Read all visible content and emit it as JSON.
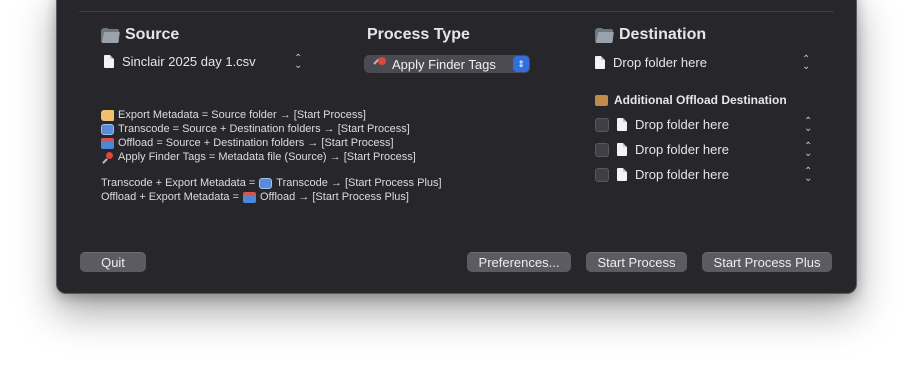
{
  "source": {
    "header": "Source",
    "file_name": "Sinclair 2025 day 1.csv"
  },
  "process_type": {
    "header": "Process Type",
    "selected": "Apply Finder Tags"
  },
  "destination": {
    "header": "Destination",
    "placeholder": "Drop folder here"
  },
  "additional_offload": {
    "header": "Additional Offload Destination",
    "rows": [
      {
        "label": "Drop folder here",
        "checked": false
      },
      {
        "label": "Drop folder here",
        "checked": false
      },
      {
        "label": "Drop folder here",
        "checked": false
      }
    ]
  },
  "info_lines": [
    {
      "icon": "tag-icon",
      "text": "Export Metadata = Source folder → [Start Process]"
    },
    {
      "icon": "transcode-icon",
      "text": "Transcode = Source + Destination folders → [Start Process]"
    },
    {
      "icon": "offload-icon",
      "text": "Offload = Source + Destination folders → [Start Process]"
    },
    {
      "icon": "pushpin-icon",
      "text": "Apply Finder Tags = Metadata file (Source) → [Start Process]"
    }
  ],
  "combo_lines": [
    {
      "prefix": "Transcode + Export Metadata =",
      "icon": "transcode-icon",
      "suffix": "Transcode → [Start Process Plus]"
    },
    {
      "prefix": "Offload + Export Metadata =",
      "icon": "offload-icon",
      "suffix": "Offload → [Start Process Plus]"
    }
  ],
  "buttons": {
    "quit": "Quit",
    "preferences": "Preferences...",
    "start_process": "Start Process",
    "start_process_plus": "Start Process Plus"
  },
  "colors": {
    "window_bg": "#26262b",
    "accent_blue": "#2f6fe0",
    "button_bg": "#5b5b61"
  }
}
